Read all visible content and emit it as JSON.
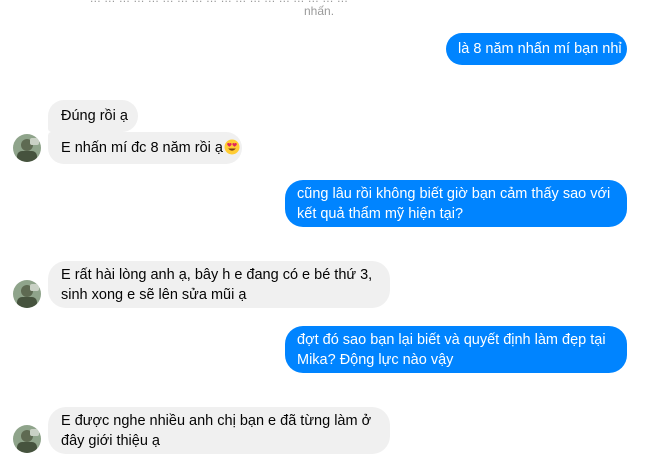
{
  "top_fragment": {
    "cut_text": "... ... ... ... ... ... ... ... ... ... ... ... ... ... ... ... ... ...",
    "tail_text": "nhấn."
  },
  "messages": [
    {
      "id": "m1",
      "sender": "me",
      "lines": [
        "là 8 năm nhấn mí bạn nhỉ"
      ]
    },
    {
      "id": "m2",
      "sender": "other",
      "lines": [
        "Đúng rồi ạ"
      ]
    },
    {
      "id": "m3",
      "sender": "other",
      "lines": [
        "E nhấn mí đc 8 năm rồi ạ"
      ],
      "emoji": "heart-eyes-emoji"
    },
    {
      "id": "m4",
      "sender": "me",
      "lines": [
        "cũng lâu rồi không biết giờ bạn cảm thấy sao với",
        "kết quả thẩm mỹ hiện tại?"
      ]
    },
    {
      "id": "m5",
      "sender": "other",
      "lines": [
        "E rất hài lòng anh ạ, bây h e đang có e bé thứ 3,",
        "sinh xong e sẽ lên sửa mũi ạ"
      ]
    },
    {
      "id": "m6",
      "sender": "me",
      "lines": [
        "đợt đó sao bạn lại biết và quyết định làm đẹp tại",
        "Mika? Động lực nào vậy"
      ]
    },
    {
      "id": "m7",
      "sender": "other",
      "lines": [
        "E được nghe nhiều anh chị bạn e đã từng làm ở",
        "đây giới thiệu ạ"
      ]
    }
  ],
  "colors": {
    "outgoing_bubble": "#0084ff",
    "incoming_bubble": "#f0f0f0",
    "outgoing_text": "#ffffff",
    "incoming_text": "#050505"
  }
}
